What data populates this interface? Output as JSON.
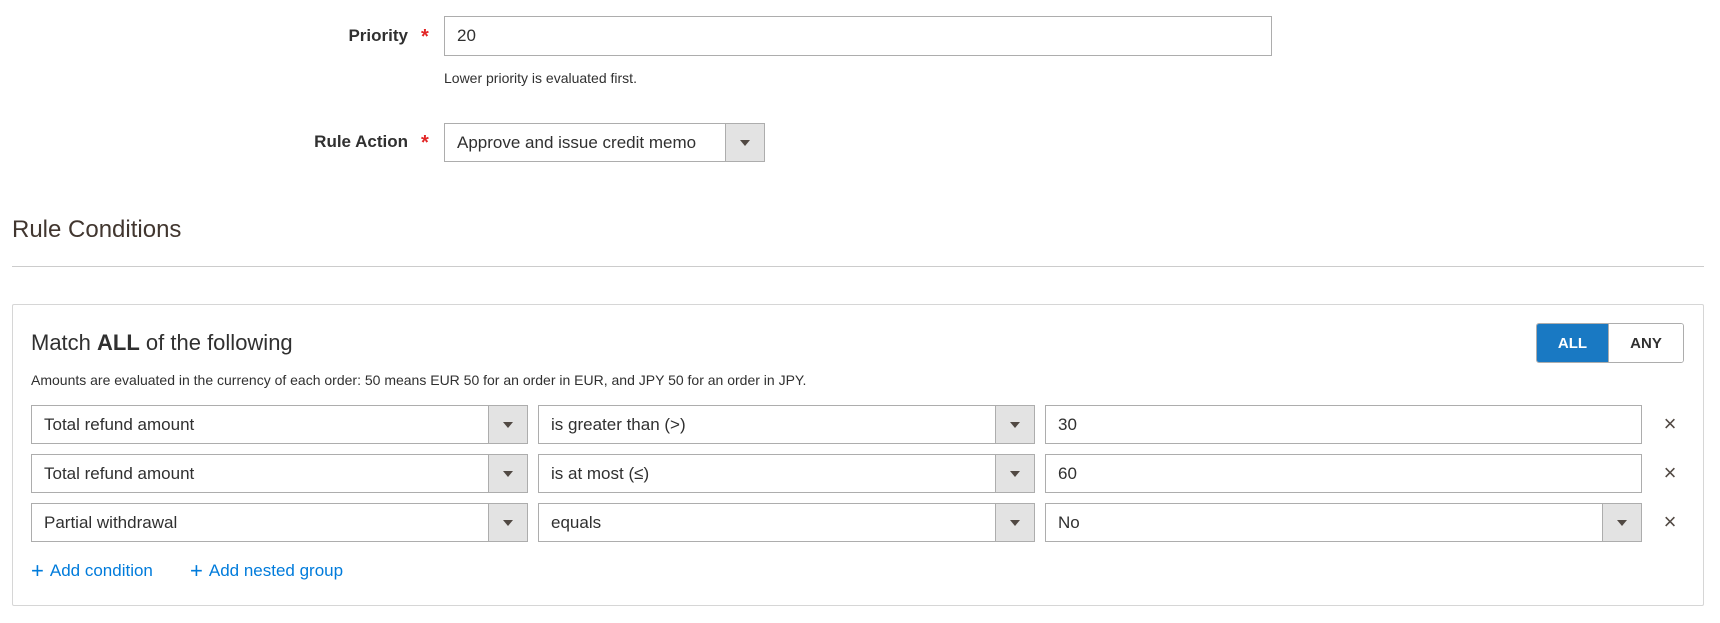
{
  "priority": {
    "label": "Priority",
    "required_mark": "*",
    "value": "20",
    "note": "Lower priority is evaluated first."
  },
  "rule_action": {
    "label": "Rule Action",
    "required_mark": "*",
    "selected": "Approve and issue credit memo"
  },
  "rule_conditions": {
    "title": "Rule Conditions",
    "match_prefix": "Match ",
    "match_mode": "ALL",
    "match_suffix": " of the following",
    "toggle": {
      "all_label": "ALL",
      "any_label": "ANY",
      "active": "ALL"
    },
    "note": "Amounts are evaluated in the currency of each order: 50 means EUR 50 for an order in EUR, and JPY 50 for an order in JPY.",
    "rows": [
      {
        "attribute": "Total refund amount",
        "operator": "is greater than (>)",
        "value": "30",
        "value_type": "input"
      },
      {
        "attribute": "Total refund amount",
        "operator": "is at most (≤)",
        "value": "60",
        "value_type": "input"
      },
      {
        "attribute": "Partial withdrawal",
        "operator": "equals",
        "value": "No",
        "value_type": "select"
      }
    ],
    "remove_icon": "×",
    "add_condition_label": "Add condition",
    "add_group_label": "Add nested group",
    "plus_icon": "+"
  },
  "colors": {
    "accent": "#1979c3",
    "link": "#007bdb",
    "required": "#e22626"
  }
}
